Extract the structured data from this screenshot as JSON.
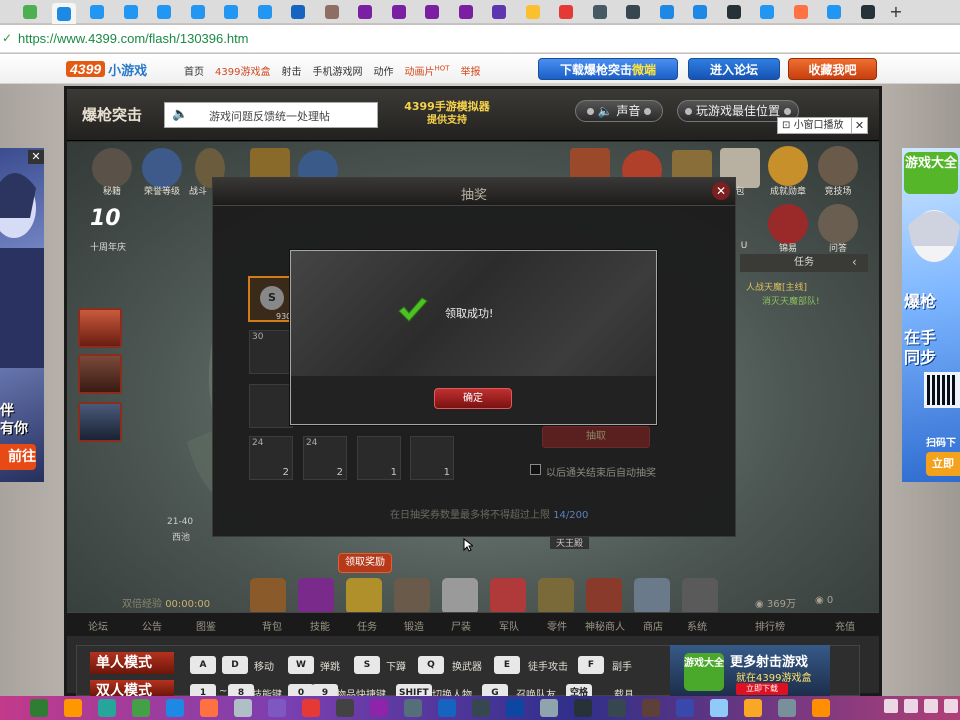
{
  "browser": {
    "tabs": [
      {
        "color": "#4caf50",
        "active": false
      },
      {
        "color": "#1e88e5",
        "active": true
      },
      {
        "color": "#2196f3",
        "active": false
      },
      {
        "color": "#2196f3",
        "active": false
      },
      {
        "color": "#2196f3",
        "active": false
      },
      {
        "color": "#2196f3",
        "active": false
      },
      {
        "color": "#2196f3",
        "active": false
      },
      {
        "color": "#2196f3",
        "active": false
      },
      {
        "color": "#1565c0",
        "active": false
      },
      {
        "color": "#8d6e63",
        "active": false
      },
      {
        "color": "#7b1fa2",
        "active": false
      },
      {
        "color": "#7b1fa2",
        "active": false
      },
      {
        "color": "#7b1fa2",
        "active": false
      },
      {
        "color": "#7b1fa2",
        "active": false
      },
      {
        "color": "#5e35b1",
        "active": false
      },
      {
        "color": "#fbc02d",
        "active": false
      },
      {
        "color": "#e53935",
        "active": false
      },
      {
        "color": "#455a64",
        "active": false
      },
      {
        "color": "#37474f",
        "active": false
      },
      {
        "color": "#1e88e5",
        "active": false
      },
      {
        "color": "#1e88e5",
        "active": false
      },
      {
        "color": "#263238",
        "active": false
      },
      {
        "color": "#2196f3",
        "active": false
      },
      {
        "color": "#ff7043",
        "active": false
      },
      {
        "color": "#2196f3",
        "active": false
      },
      {
        "color": "#263238",
        "active": false
      }
    ],
    "new_tab": "+",
    "url": "https://www.4399.com/flash/130396.htm"
  },
  "site": {
    "logo_a": "4399",
    "logo_b": "小游戏",
    "nav": [
      "首页",
      "4399游戏盒",
      "射击",
      "手机游戏网",
      "动作",
      "动画片",
      "举报"
    ],
    "nav_hot": "HOT",
    "btn_download_a": "下载爆枪突击",
    "btn_download_b": "微端",
    "btn_forum": "进入论坛",
    "btn_fav": "收藏我吧"
  },
  "ads": {
    "left_lines": [
      "伴",
      "有你"
    ],
    "left_cta": "前往",
    "left_close": "✕",
    "right_badge": "游戏大全",
    "right_t1": "爆枪",
    "right_t2": "在手",
    "right_t3": "同步",
    "right_scan": "扫码下",
    "right_cta": "立即"
  },
  "game": {
    "title": "爆枪突击",
    "feedback": "游戏问题反馈统一处理帖",
    "emulator_line1": "4399手游模拟器",
    "emulator_line2": "提供支持",
    "sound": "声音",
    "best_pos": "玩游戏最佳位置",
    "mini_window": "小窗口播放",
    "mini_close": "✕",
    "top_icons": [
      "秘籍",
      "荣誉等级",
      "战斗"
    ],
    "right_icons": [
      "包",
      "成就勋章",
      "竞技场"
    ],
    "right_icons2": [
      "U",
      "锦易",
      "问答"
    ],
    "ten_years_num": "10",
    "ten_years": "十周年庆",
    "task_head": "任务",
    "task_1": "人战天魔[主线]",
    "task_2": "消灭天魔部队!",
    "lottery": {
      "title": "抽奖",
      "close": "✕",
      "main_qty": "930",
      "slots": [
        {
          "n": "30",
          "q": ""
        },
        {
          "n": "",
          "q": ""
        },
        {
          "n": "24",
          "q": "2"
        },
        {
          "n": "24",
          "q": "2"
        },
        {
          "n": "",
          "q": "1"
        },
        {
          "n": "",
          "q": "1"
        }
      ],
      "draw": "抽取",
      "auto_draw": "以后通关结束后自动抽奖",
      "footer_a": "在日抽奖券数量最多将不得超过上限",
      "footer_count": "14/200"
    },
    "modal": {
      "message": "领取成功!",
      "ok": "确定"
    },
    "map_coord": "21-40",
    "map_name": "西池",
    "boss": "天王殿",
    "pickup": "领取奖励",
    "exp_label": "双倍经验",
    "exp_time": "00:00:00",
    "coins": "369万",
    "gold": "0",
    "menu": [
      "论坛",
      "公告",
      "图鉴",
      "背包",
      "技能",
      "任务",
      "锻造",
      "尸装",
      "军队",
      "零件",
      "神秘商人",
      "商店",
      "系统",
      "排行榜",
      "充值"
    ]
  },
  "controls": {
    "mode_single": "单人模式",
    "mode_double": "双人模式",
    "row1": [
      {
        "k": "A",
        "l": ""
      },
      {
        "k": "D",
        "l": "移动"
      },
      {
        "k": "W",
        "l": "弹跳"
      },
      {
        "k": "S",
        "l": "下蹲"
      },
      {
        "k": "Q",
        "l": "换武器"
      },
      {
        "k": "E",
        "l": "徒手攻击"
      },
      {
        "k": "F",
        "l": "副手"
      }
    ],
    "row2": [
      {
        "k": "1",
        "l": "~"
      },
      {
        "k": "8",
        "l": "技能键"
      },
      {
        "k": "0",
        "l": ""
      },
      {
        "k": "9",
        "l": "物品快捷键"
      },
      {
        "k": "SHIFT",
        "l": "切换人物"
      },
      {
        "k": "G",
        "l": "召唤队友"
      },
      {
        "k": "空格",
        "l": "载具"
      }
    ],
    "promo_badge": "游戏大全",
    "promo_t1": "更多射击游戏",
    "promo_t2": "就在4399游戏盒",
    "promo_t3": "立即下载"
  },
  "taskbar": {
    "icons": [
      "#2e7d32",
      "#ff9800",
      "#26a69a",
      "#43a047",
      "#1e88e5",
      "#ff7043",
      "#b0bec5",
      "#7e57c2",
      "#e53935",
      "#424242",
      "#8e24aa",
      "#546e7a",
      "#1565c0",
      "#37474f",
      "#0d47a1",
      "#90a4ae",
      "#263238",
      "#37474f",
      "#5d4037",
      "#3949ab",
      "#90caf9",
      "#f9a825",
      "#78909c",
      "#ff8f00"
    ]
  }
}
